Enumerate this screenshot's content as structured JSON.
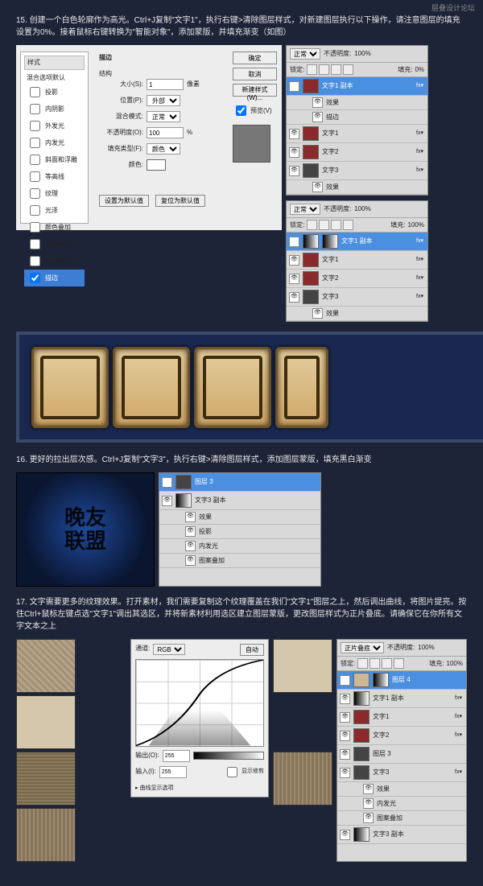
{
  "watermark": "层叠设计论坛",
  "steps": {
    "s15": "15. 创建一个白色轮廓作为高光。Ctrl+J复制\"文字1\"，执行右键>清除图层样式，对新建图层执行以下操作，请注意图层的填充设置为0%。接着鼠标右键转换为\"智能对象\"，添加蒙版，并填充渐变（如图）",
    "s16": "16. 更好的拉出层次感。Ctrl+J复制\"文字3\"，执行右键>清除图层样式，添加图层蒙版，填充黑白渐变",
    "s17": "17. 文字需要更多的纹理效果。打开素材，我们需要复制这个纹理覆盖在我们\"文字1\"图层之上，然后调出曲线，将图片提亮。按住Ctrl+鼠标左键点选\"文字1\"调出其选区，并将新素材利用选区建立图层蒙版，更改图层样式为正片叠底。请确保它在你所有文字文本之上"
  },
  "styleDialog": {
    "sideHeader": "样式",
    "blendHeader": "混合选项默认",
    "items": [
      "投影",
      "内阴影",
      "外发光",
      "内发光",
      "斜面和浮雕",
      "等高线",
      "纹理",
      "光泽",
      "颜色叠加",
      "渐变叠加",
      "图案叠加"
    ],
    "selected": "描边",
    "title": "描边",
    "section": "结构",
    "sizeLabel": "大小(S):",
    "sizeVal": "1",
    "sizeUnit": "像素",
    "posLabel": "位置(P):",
    "posVal": "外部",
    "blendLabel": "混合模式:",
    "blendVal": "正常",
    "opLabel": "不透明度(O):",
    "opVal": "100",
    "opUnit": "%",
    "fillTypeLabel": "填充类型(F):",
    "fillTypeVal": "颜色",
    "colorLabel": "颜色:",
    "defBtn": "设置为默认值",
    "resetBtn": "复位为默认值",
    "ok": "确定",
    "cancel": "取消",
    "newStyle": "新建样式(W)...",
    "preview": "预览(V)"
  },
  "layersA": {
    "mode": "正常",
    "opLabel": "不透明度:",
    "opVal": "100%",
    "lockLabel": "锁定:",
    "fillLabel": "填充:",
    "fillVal": "0%",
    "items": [
      {
        "name": "文字1 副本",
        "sel": true,
        "thumb": "r",
        "fx": true
      },
      {
        "name": "效果",
        "sub": true
      },
      {
        "name": "描边",
        "sub": true
      },
      {
        "name": "文字1",
        "thumb": "r",
        "fx": true
      },
      {
        "name": "文字2",
        "thumb": "r",
        "fx": true
      },
      {
        "name": "文字3",
        "thumb": "txt",
        "fx": true
      },
      {
        "name": "效果",
        "sub": true
      }
    ]
  },
  "layersB": {
    "mode": "正常",
    "opLabel": "不透明度:",
    "opVal": "100%",
    "lockLabel": "锁定:",
    "fillLabel": "填充:",
    "fillVal": "100%",
    "items": [
      {
        "name": "文字1 副本",
        "sel": true,
        "thumb": "grad",
        "mask": true,
        "fx": true
      },
      {
        "name": "文字1",
        "thumb": "r",
        "fx": true
      },
      {
        "name": "文字2",
        "thumb": "r",
        "fx": true
      },
      {
        "name": "文字3",
        "thumb": "txt",
        "fx": true
      },
      {
        "name": "效果",
        "sub": true
      }
    ]
  },
  "layersC": {
    "items": [
      {
        "name": "图层 3",
        "sel": true,
        "thumb": "txt"
      },
      {
        "name": "文字3 副本",
        "thumb": "grad"
      },
      {
        "name": "效果",
        "sub": true
      },
      {
        "name": "投影",
        "sub": true
      },
      {
        "name": "内发光",
        "sub": true
      },
      {
        "name": "图案叠加",
        "sub": true
      }
    ]
  },
  "curves": {
    "channel": "通道:",
    "channelVal": "RGB",
    "auto": "自动",
    "outLabel": "输出(O):",
    "outVal": "255",
    "inLabel": "输入(I):",
    "inVal": "255",
    "showClip": "显示修剪",
    "curveOpt": "曲线显示选项"
  },
  "layersD": {
    "mode": "正片叠底",
    "opLabel": "不透明度:",
    "opVal": "100%",
    "lockLabel": "锁定:",
    "fillLabel": "填充:",
    "fillVal": "100%",
    "items": [
      {
        "name": "图层 4",
        "sel": true,
        "thumb": "crack",
        "mask": true
      },
      {
        "name": "文字1 副本",
        "thumb": "grad",
        "fx": true
      },
      {
        "name": "文字1",
        "thumb": "r",
        "fx": true
      },
      {
        "name": "文字2",
        "thumb": "r",
        "fx": true
      },
      {
        "name": "图层 3",
        "thumb": "txt"
      },
      {
        "name": "文字3",
        "thumb": "txt",
        "fx": true
      },
      {
        "name": "效果",
        "sub": true
      },
      {
        "name": "内发光",
        "sub": true
      },
      {
        "name": "图案叠加",
        "sub": true
      },
      {
        "name": "文字3 副本",
        "thumb": "grad"
      }
    ]
  },
  "render": {
    "line1": "晚友",
    "line2": "联盟"
  }
}
